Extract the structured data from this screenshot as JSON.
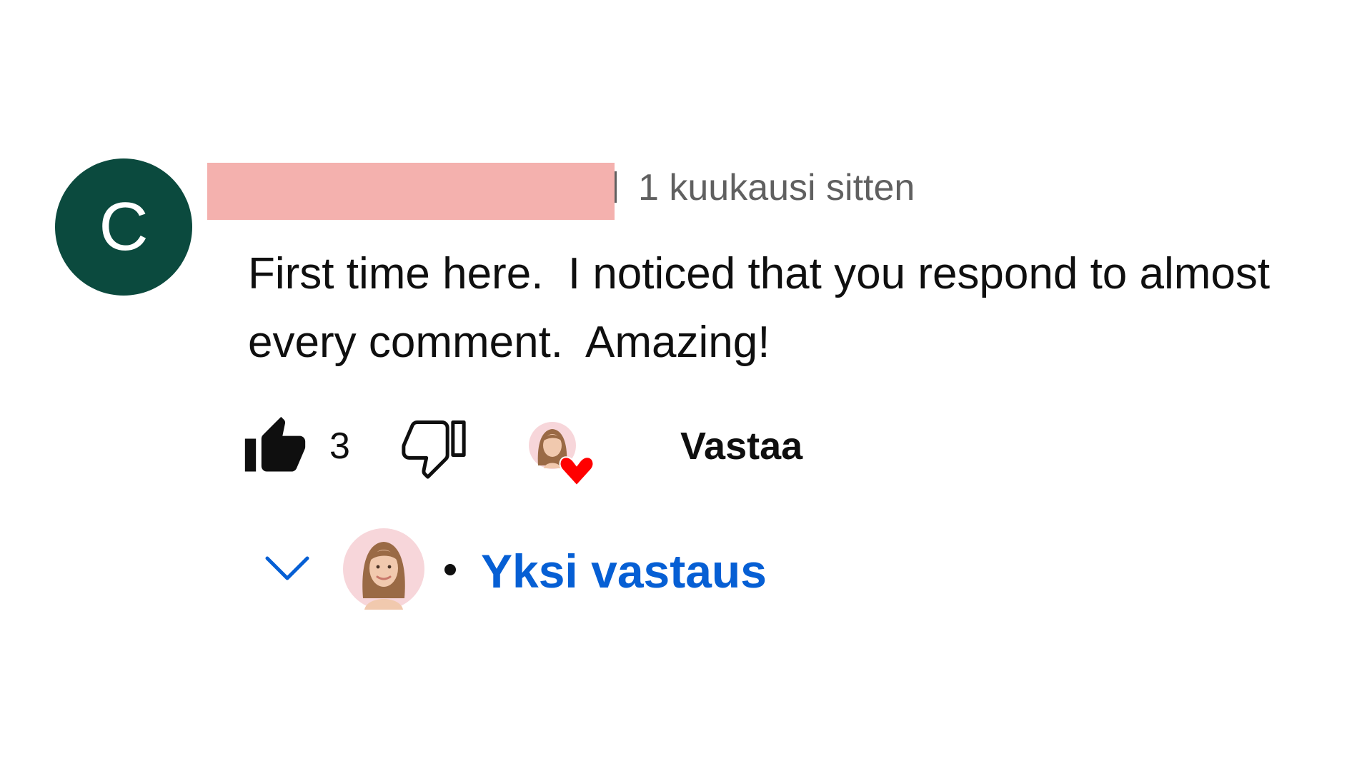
{
  "comment": {
    "avatar_letter": "C",
    "avatar_color": "#0b4a3e",
    "timestamp": "1 kuukausi sitten",
    "text": "First time here.  I noticed that you respond to almost\nevery comment.  Amazing!",
    "like_count": "3",
    "reply_label": "Vastaa",
    "icons": {
      "like": "thumbs-up-filled-icon",
      "dislike": "thumbs-down-outline-icon",
      "creator_heart": "creator-heart-icon"
    },
    "colors": {
      "heart": "#ff0000",
      "redaction": "#f4b1ae"
    }
  },
  "replies": {
    "toggle_icon": "chevron-down-icon",
    "label": "Yksi vastaus",
    "link_color": "#065fd4"
  }
}
